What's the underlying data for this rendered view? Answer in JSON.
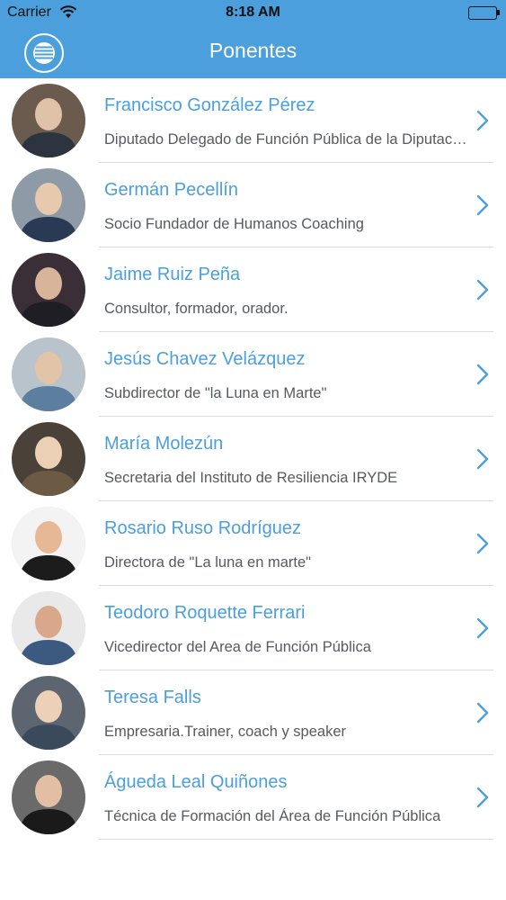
{
  "status_bar": {
    "carrier": "Carrier",
    "time": "8:18 AM",
    "icons": [
      "wifi-icon",
      "battery-icon"
    ]
  },
  "nav": {
    "title": "Ponentes",
    "menu_icon": "menu-icon"
  },
  "colors": {
    "accent": "#4a9fdc",
    "name_text": "#4a9fdc",
    "role_text": "#555a5e",
    "divider": "#dcdcdc"
  },
  "speakers": [
    {
      "name": "Francisco González Pérez",
      "role": "Diputado Delegado de Función Pública de la Diputación"
    },
    {
      "name": "Germán Pecellín",
      "role": "Socio Fundador  de Humanos Coaching"
    },
    {
      "name": "Jaime Ruiz Peña",
      "role": "Consultor, formador, orador."
    },
    {
      "name": "Jesús Chavez Velázquez",
      "role": "Subdirector de \"la Luna en Marte\""
    },
    {
      "name": "María Molezún",
      "role": "Secretaria del Instituto de Resiliencia IRYDE"
    },
    {
      "name": "Rosario Ruso Rodríguez",
      "role": "Directora de \"La luna en marte\""
    },
    {
      "name": "Teodoro Roquette Ferrari",
      "role": "Vicedirector del Area de Función Pública"
    },
    {
      "name": "Teresa Falls",
      "role": "Empresaria.Trainer, coach y speaker"
    },
    {
      "name": "Águeda Leal Quiñones",
      "role": "Técnica de Formación del Área de Función Pública"
    }
  ]
}
